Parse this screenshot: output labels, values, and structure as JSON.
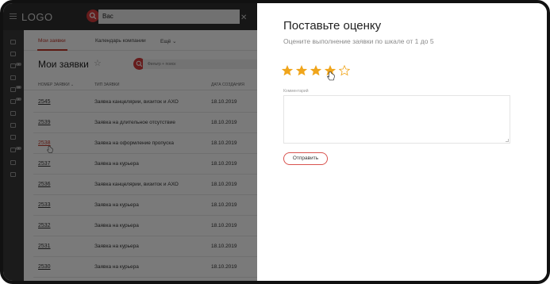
{
  "topbar": {
    "logo": "LOGO",
    "search_value": "Вас"
  },
  "main": {
    "tabs": [
      {
        "label": "Мои заявки",
        "active": true
      },
      {
        "label": "Календарь компании",
        "active": false
      },
      {
        "label": "Ещё ⌄",
        "active": false
      }
    ],
    "page_title": "Мои заявки",
    "filter_placeholder": "Фильтр + поиск",
    "columns": [
      "НОМЕР ЗАЯВКИ ⌄",
      "ТИП ЗАЯВКИ",
      "ДАТА СОЗДАНИЯ"
    ],
    "rows": [
      {
        "number": "2545",
        "type": "Заявка канцелярии, визиток и АХО",
        "date": "18.10.2019"
      },
      {
        "number": "2539",
        "type": "Заявка на длительное отсутствие",
        "date": "18.10.2019"
      },
      {
        "number": "2538",
        "type": "Заявка на оформление пропуска",
        "date": "18.10.2019"
      },
      {
        "number": "2537",
        "type": "Заявка на курьера",
        "date": "18.10.2019"
      },
      {
        "number": "2536",
        "type": "Заявка канцелярии, визиток и АХО",
        "date": "18.10.2019"
      },
      {
        "number": "2533",
        "type": "Заявка на курьера",
        "date": "18.10.2019"
      },
      {
        "number": "2532",
        "type": "Заявка на курьера",
        "date": "18.10.2019"
      },
      {
        "number": "2531",
        "type": "Заявка на курьера",
        "date": "18.10.2019"
      },
      {
        "number": "2530",
        "type": "Заявка на курьера",
        "date": "18.10.2019"
      }
    ],
    "sidebar_badges": [
      "2",
      "15",
      "2",
      "3"
    ]
  },
  "panel": {
    "title": "Поставьте оценку",
    "subtitle": "Оцените выполнение заявки по шкале от 1 до 5",
    "rating": {
      "value": 4,
      "max": 5
    },
    "comment_label": "Комментарий",
    "comment_value": "",
    "send_label": "Отправить"
  },
  "colors": {
    "accent": "#d63b3b",
    "star_filled": "#f0a51b",
    "star_empty": "#f0a51b"
  }
}
